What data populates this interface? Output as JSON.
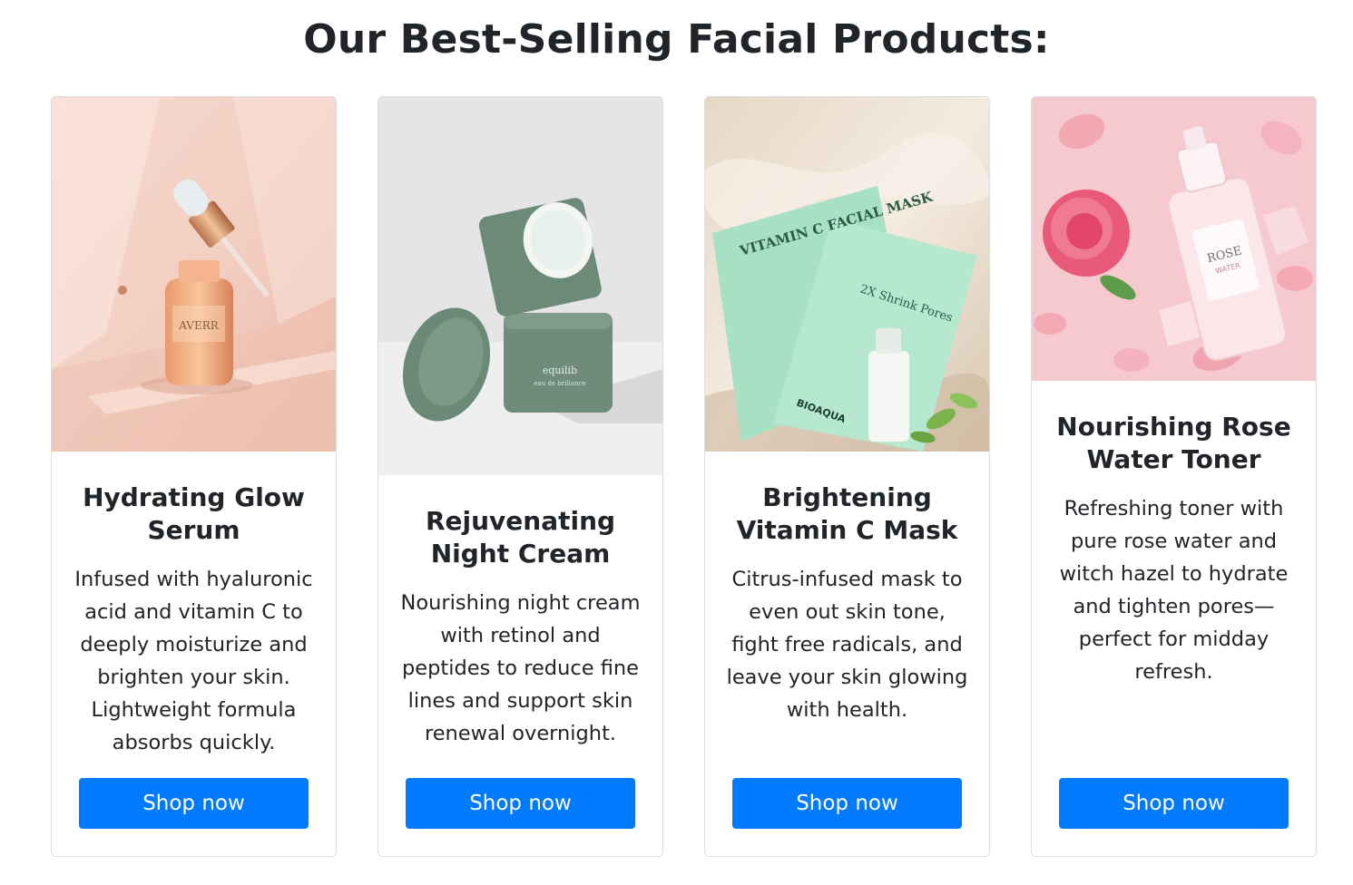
{
  "page": {
    "title": "Our Best-Selling Facial Products:"
  },
  "products": [
    {
      "name": "Hydrating Glow Serum",
      "description": "Infused with hyaluronic acid and vitamin C to deeply moisturize and brighten your skin. Lightweight formula absorbs quickly.",
      "button_label": "Shop now",
      "image_text": "AVERR"
    },
    {
      "name": "Rejuvenating Night Cream",
      "description": "Nourishing night cream with retinol and peptides to reduce fine lines and support skin renewal overnight.",
      "button_label": "Shop now",
      "image_text": "equilib",
      "image_subtext": "eau de brillance"
    },
    {
      "name": "Brightening Vitamin C Mask",
      "description": "Citrus-infused mask to even out skin tone, fight free radicals, and leave your skin glowing with health.",
      "button_label": "Shop now",
      "image_text": "VITAMIN C FACIAL MASK",
      "image_subtext": "2X Shrink Pores",
      "image_brand": "BIOAQUA"
    },
    {
      "name": "Nourishing Rose Water Toner",
      "description": "Refreshing toner with pure rose water and witch hazel to hydrate and tighten pores—perfect for midday refresh.",
      "button_label": "Shop now",
      "image_text": "ROSE",
      "image_subtext": "WATER"
    }
  ],
  "colors": {
    "button": "#007bff",
    "button_text": "#ffffff",
    "heading": "#212529"
  }
}
